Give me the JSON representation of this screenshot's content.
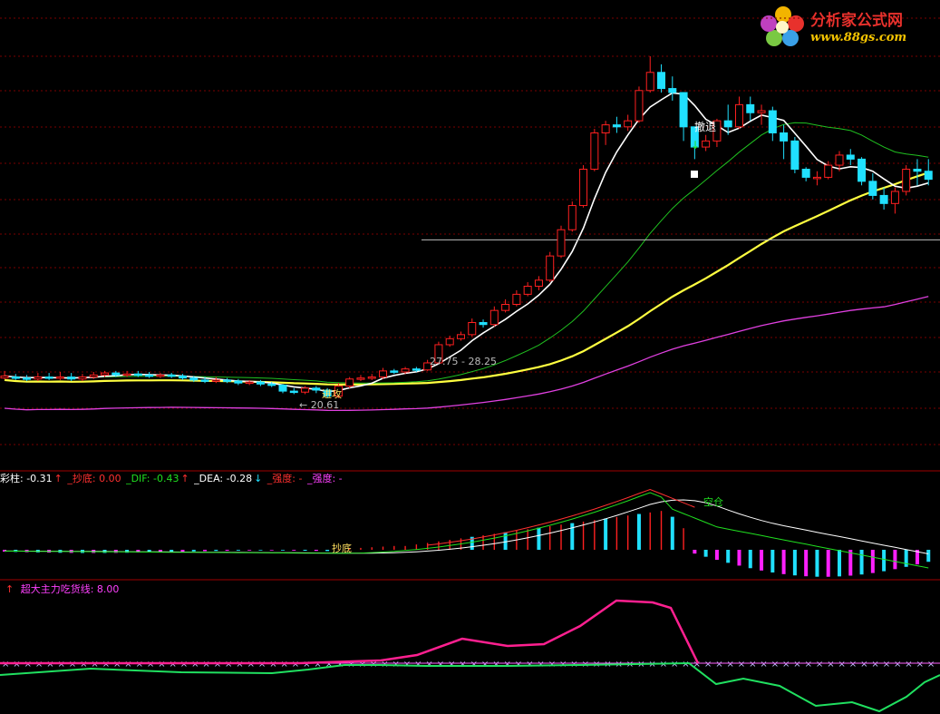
{
  "watermark": {
    "name": "分析家公式网",
    "url": "www.88gs.com"
  },
  "price_pane": {
    "annotations": {
      "retreat": "撤退",
      "attack": "进攻",
      "low_label": "← 20.61",
      "range_label": "27.75 - 28.25"
    }
  },
  "macd_pane": {
    "legend": [
      {
        "text": "彩柱: -0.31",
        "color": "#ffffff"
      },
      {
        "text": "↑",
        "color": "#ff3030"
      },
      {
        "text": "  _抄底: 0.00",
        "color": "#ff3030"
      },
      {
        "text": "  _DIF: -0.43",
        "color": "#20e020"
      },
      {
        "text": "↑",
        "color": "#ff3030"
      },
      {
        "text": "  _DEA: -0.28",
        "color": "#ffffff"
      },
      {
        "text": "↓",
        "color": "#20e0ff"
      },
      {
        "text": "  _强度: -",
        "color": "#ff3030"
      },
      {
        "text": "  _强度: -",
        "color": "#ff40ff"
      }
    ],
    "annotations": {
      "bottom": "抄底",
      "empty": "空仓"
    }
  },
  "main_force_pane": {
    "legend_arrow": "↑",
    "legend_text": "超大主力吃货线: 8.00"
  },
  "colors": {
    "up": "#ff2020",
    "down": "#20e0ff",
    "ma_white": "#ffffff",
    "ma_green": "#20c020",
    "ma_yellow": "#ffff40",
    "ma_magenta": "#e040e0",
    "grid": "#7a0000",
    "pink": "#ff2090",
    "green": "#20e060"
  },
  "chart_data": [
    {
      "type": "candlestick",
      "title": "",
      "candles": [
        [
          20.05,
          20.15,
          20.4,
          20.0
        ],
        [
          20.1,
          20.05,
          20.25,
          19.95
        ],
        [
          20.05,
          20.0,
          20.2,
          19.9
        ],
        [
          20.0,
          20.1,
          20.3,
          19.9
        ],
        [
          20.1,
          20.05,
          20.3,
          19.95
        ],
        [
          20.05,
          20.1,
          20.35,
          19.95
        ],
        [
          20.1,
          20.0,
          20.3,
          19.9
        ],
        [
          20.0,
          20.1,
          20.25,
          19.9
        ],
        [
          20.1,
          20.2,
          20.35,
          20.0
        ],
        [
          20.2,
          20.3,
          20.4,
          20.1
        ],
        [
          20.3,
          20.2,
          20.4,
          20.1
        ],
        [
          20.2,
          20.25,
          20.4,
          20.1
        ],
        [
          20.25,
          20.2,
          20.4,
          20.1
        ],
        [
          20.2,
          20.15,
          20.35,
          20.05
        ],
        [
          20.15,
          20.2,
          20.3,
          20.05
        ],
        [
          20.2,
          20.15,
          20.3,
          20.05
        ],
        [
          20.15,
          20.05,
          20.25,
          19.95
        ],
        [
          20.05,
          19.95,
          20.15,
          19.85
        ],
        [
          19.95,
          19.9,
          20.1,
          19.8
        ],
        [
          19.9,
          19.95,
          20.1,
          19.8
        ],
        [
          19.95,
          19.9,
          20.05,
          19.8
        ],
        [
          19.9,
          19.8,
          20.0,
          19.7
        ],
        [
          19.8,
          19.85,
          19.95,
          19.7
        ],
        [
          19.85,
          19.75,
          19.95,
          19.65
        ],
        [
          19.75,
          19.7,
          19.85,
          19.6
        ],
        [
          19.7,
          19.4,
          19.75,
          19.3
        ],
        [
          19.4,
          19.35,
          19.55,
          19.25
        ],
        [
          19.35,
          19.55,
          19.65,
          19.25
        ],
        [
          19.55,
          19.45,
          19.65,
          19.3
        ],
        [
          19.45,
          19.15,
          19.55,
          19.05
        ],
        [
          19.15,
          19.65,
          19.8,
          19.05
        ],
        [
          19.65,
          20.0,
          20.1,
          19.55
        ],
        [
          20.0,
          20.05,
          20.2,
          19.9
        ],
        [
          20.05,
          20.1,
          20.25,
          19.95
        ],
        [
          20.1,
          20.4,
          20.55,
          20.0
        ],
        [
          20.4,
          20.35,
          20.5,
          20.25
        ],
        [
          20.35,
          20.5,
          20.6,
          20.25
        ],
        [
          20.5,
          20.45,
          20.6,
          20.35
        ],
        [
          20.45,
          20.8,
          20.95,
          20.4
        ],
        [
          20.8,
          21.7,
          21.85,
          20.75
        ],
        [
          21.7,
          22.0,
          22.15,
          21.6
        ],
        [
          22.0,
          22.2,
          22.35,
          21.9
        ],
        [
          22.2,
          22.8,
          23.0,
          22.1
        ],
        [
          22.8,
          22.7,
          22.95,
          22.55
        ],
        [
          22.7,
          23.4,
          23.6,
          22.6
        ],
        [
          23.4,
          23.7,
          23.95,
          23.3
        ],
        [
          23.7,
          24.2,
          24.4,
          23.6
        ],
        [
          24.2,
          24.6,
          24.8,
          24.1
        ],
        [
          24.6,
          24.9,
          25.1,
          24.4
        ],
        [
          24.9,
          26.1,
          26.3,
          24.8
        ],
        [
          26.1,
          27.4,
          27.6,
          26.0
        ],
        [
          27.4,
          28.6,
          28.8,
          27.3
        ],
        [
          28.6,
          30.4,
          30.6,
          28.5
        ],
        [
          30.4,
          32.2,
          32.4,
          30.3
        ],
        [
          32.2,
          32.6,
          32.8,
          31.6
        ],
        [
          32.6,
          32.5,
          33.0,
          32.2
        ],
        [
          32.5,
          32.8,
          33.1,
          32.3
        ],
        [
          32.8,
          34.3,
          34.5,
          32.7
        ],
        [
          34.3,
          35.2,
          36.0,
          34.2
        ],
        [
          35.2,
          34.4,
          35.6,
          34.2
        ],
        [
          34.4,
          34.2,
          35.0,
          33.8
        ],
        [
          34.2,
          32.5,
          33.1,
          31.8
        ],
        [
          32.5,
          31.5,
          32.1,
          30.9
        ],
        [
          31.5,
          31.8,
          32.1,
          31.3
        ],
        [
          31.8,
          32.8,
          32.9,
          31.5
        ],
        [
          32.8,
          32.5,
          33.6,
          32.1
        ],
        [
          32.5,
          33.6,
          34.0,
          32.4
        ],
        [
          33.6,
          33.2,
          34.0,
          32.8
        ],
        [
          33.2,
          33.3,
          33.6,
          32.6
        ],
        [
          33.3,
          32.2,
          33.5,
          31.8
        ],
        [
          32.2,
          31.8,
          32.6,
          30.9
        ],
        [
          31.8,
          30.4,
          32.0,
          30.2
        ],
        [
          30.4,
          30.0,
          30.5,
          29.8
        ],
        [
          30.0,
          30.0,
          30.3,
          29.6
        ],
        [
          30.0,
          30.6,
          30.8,
          29.9
        ],
        [
          30.6,
          31.1,
          31.3,
          30.3
        ],
        [
          31.1,
          30.9,
          31.4,
          30.6
        ],
        [
          30.9,
          29.8,
          31.0,
          29.6
        ],
        [
          29.8,
          29.1,
          30.2,
          28.9
        ],
        [
          29.1,
          28.7,
          29.5,
          28.4
        ],
        [
          28.7,
          29.3,
          29.5,
          28.2
        ],
        [
          29.3,
          30.4,
          30.6,
          29.1
        ],
        [
          30.4,
          30.3,
          30.9,
          29.6
        ],
        [
          30.3,
          29.9,
          30.9,
          29.6
        ]
      ]
    }
  ]
}
